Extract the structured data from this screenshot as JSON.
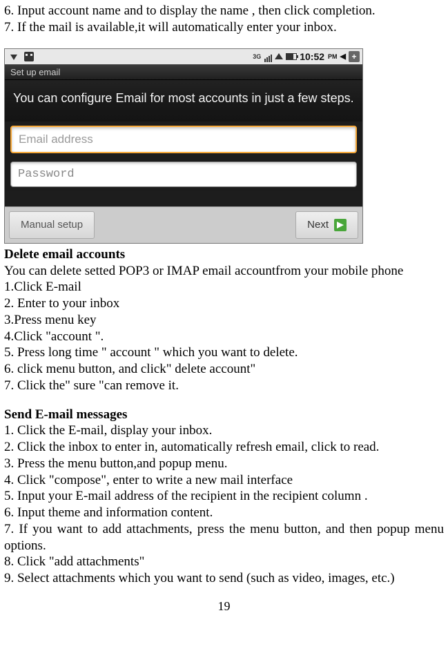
{
  "doc": {
    "step6": "6. Input account name and to display the name , then click completion.",
    "step7": "7. If the mail is available,it will automatically enter your inbox.",
    "delete_heading": "Delete email accounts",
    "delete_intro": "You can delete setted POP3 or IMAP  email accountfrom your mobile phone",
    "delete_steps": {
      "s1": "1.Click E-mail",
      "s2": "2. Enter to your inbox",
      "s3": "3.Press menu key",
      "s4": "4.Click \"account \".",
      "s5": "5. Press long time \" account \" which you want to delete.",
      "s6": "6. click menu button, and click\" delete account\"",
      "s7": "7. Click the\" sure \"can remove it."
    },
    "send_heading": "Send E-mail messages",
    "send_steps": {
      "s1": "1. Click the E-mail, display your inbox.",
      "s2": "2. Click the inbox to enter in, automatically refresh   email, click to read.",
      "s3": "3. Press the menu button,and popup menu.",
      "s4": "4. Click \"compose\", enter to write a new mail interface",
      "s5": "5. Input your E-mail address of the recipient in the recipient column .",
      "s6": "6. Input theme and information content.",
      "s7": "7. If you want to add attachments, press the menu button, and then popup menu options.",
      "s8": "8. Click \"add attachments\"",
      "s9": "9. Select attachments which you want to send (such as video, images, etc.)"
    },
    "page_number": "19"
  },
  "screenshot": {
    "status": {
      "network_label": "3G",
      "time": "10:52",
      "time_suffix": "PM"
    },
    "window_title": "Set up email",
    "prompt": "You can configure Email for most accounts in just a few steps.",
    "inputs": {
      "email_placeholder": "Email address",
      "password_placeholder": "Password"
    },
    "buttons": {
      "manual": "Manual setup",
      "next": "Next"
    }
  }
}
